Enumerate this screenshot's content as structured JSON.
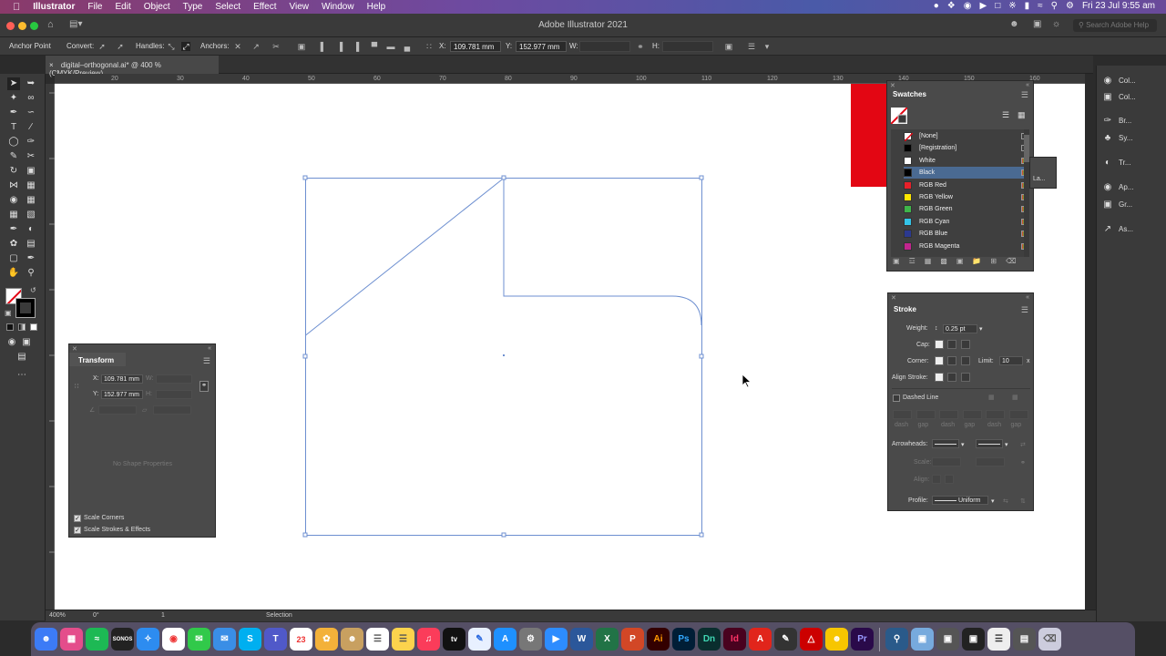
{
  "menubar": {
    "app_name": "Illustrator",
    "items": [
      "File",
      "Edit",
      "Object",
      "Type",
      "Select",
      "Effect",
      "View",
      "Window",
      "Help"
    ],
    "clock": "Fri 23 Jul 9:55 am"
  },
  "titlebar": {
    "title": "Adobe Illustrator 2021",
    "search_placeholder": "Search Adobe Help"
  },
  "controlbar": {
    "selection_label": "Anchor Point",
    "convert_label": "Convert:",
    "handles_label": "Handles:",
    "anchors_label": "Anchors:",
    "x_label": "X:",
    "x_value": "109.781 mm",
    "y_label": "Y:",
    "y_value": "152.977 mm",
    "w_label": "W:",
    "h_label": "H:"
  },
  "document_tab": {
    "close": "×",
    "label": "digital–orthogonal.ai* @ 400 % (CMYK/Preview)"
  },
  "ruler": {
    "ticks": [
      "20",
      "30",
      "40",
      "50",
      "60",
      "70",
      "80",
      "90",
      "100",
      "110",
      "120",
      "130",
      "140",
      "150",
      "160"
    ]
  },
  "transform_panel": {
    "title": "Transform",
    "x_label": "X:",
    "x_value": "109.781 mm",
    "y_label": "Y:",
    "y_value": "152.977 mm",
    "w_label": "W:",
    "h_label": "H:",
    "no_shape": "No Shape Properties",
    "scale_corners": "Scale Corners",
    "scale_strokes": "Scale Strokes & Effects"
  },
  "swatches_panel": {
    "title": "Swatches",
    "items": [
      {
        "name": "[None]",
        "color": "none"
      },
      {
        "name": "[Registration]",
        "color": "#000000"
      },
      {
        "name": "White",
        "color": "#ffffff"
      },
      {
        "name": "Black",
        "color": "#000000"
      },
      {
        "name": "RGB Red",
        "color": "#e8202a"
      },
      {
        "name": "RGB Yellow",
        "color": "#ffe600"
      },
      {
        "name": "RGB Green",
        "color": "#3fb54a"
      },
      {
        "name": "RGB Cyan",
        "color": "#33c4e8"
      },
      {
        "name": "RGB Blue",
        "color": "#2b3990"
      },
      {
        "name": "RGB Magenta",
        "color": "#c2258e"
      }
    ],
    "selected_index": 3
  },
  "stroke_panel": {
    "title": "Stroke",
    "weight_label": "Weight:",
    "weight_value": "0.25 pt",
    "cap_label": "Cap:",
    "corner_label": "Corner:",
    "limit_label": "Limit:",
    "limit_value": "10",
    "limit_unit": "x",
    "align_label": "Align Stroke:",
    "dashed_line": "Dashed Line",
    "dash_labels": [
      "dash",
      "gap",
      "dash",
      "gap",
      "dash",
      "gap"
    ],
    "arrowheads_label": "Arrowheads:",
    "scale_label": "Scale:",
    "align2_label": "Align:",
    "profile_label": "Profile:",
    "profile_value": "Uniform"
  },
  "right_dock": {
    "items": [
      "Col...",
      "Col...",
      "Br...",
      "Sy...",
      "Tr...",
      "Ap...",
      "Gr...",
      "As..."
    ]
  },
  "statusbar": {
    "zoom": "400%",
    "rotation": "0°",
    "artboard": "1",
    "tool": "Selection"
  },
  "floating_layers_label": "La...",
  "colors": {
    "accent_red": "#e30613",
    "path_blue": "#6d8fd0"
  }
}
